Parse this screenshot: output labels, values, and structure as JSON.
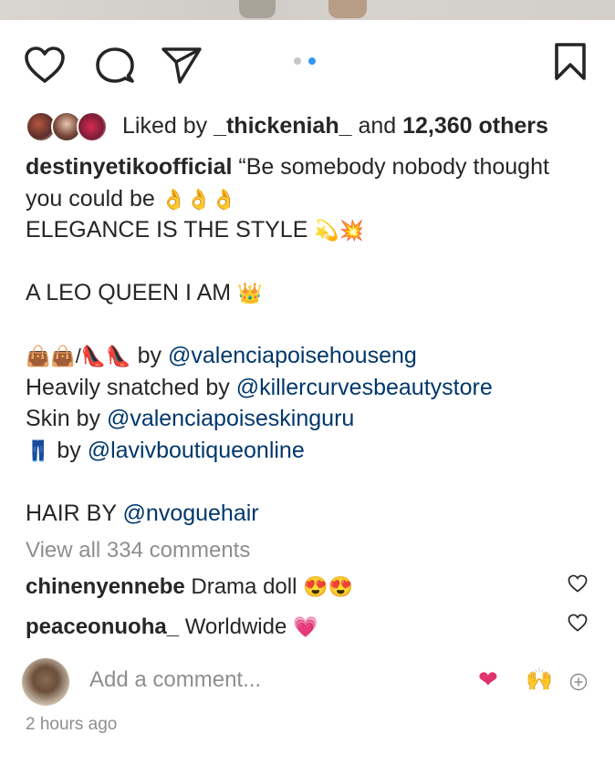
{
  "actions": {
    "like_icon": "heart-outline-icon",
    "comment_icon": "comment-bubble-icon",
    "share_icon": "paper-plane-icon",
    "save_icon": "bookmark-icon",
    "carousel_total": 2,
    "carousel_active": 2
  },
  "likes": {
    "prefix": "Liked by ",
    "user": "_thickeniah_",
    "middle": " and ",
    "count": "12,360 others"
  },
  "caption": {
    "username": "destinyetikoofficial",
    "line1_text": " “Be somebody nobody thought",
    "line2_text": "you could be ",
    "line2_emoji": "👌👌👌",
    "line3_text": "ELEGANCE IS THE STYLE ",
    "line3_emoji": "💫💥",
    "line5_text": "A LEO QUEEN I AM ",
    "line5_emoji": "👑",
    "line7_emoji": "👜👜/👠👠",
    "line7_text": " by ",
    "line7_mention": "@valenciapoisehouseng",
    "line8_text": "Heavily snatched by ",
    "line8_mention": "@killercurvesbeautystore",
    "line9_text": "Skin by ",
    "line9_mention": "@valenciapoiseskinguru",
    "line10_emoji": "👖",
    "line10_text": " by ",
    "line10_mention": "@lavivboutiqueonline",
    "line12_text": "HAIR BY ",
    "line12_mention": "@nvoguehair"
  },
  "view_all": "View all 334 comments",
  "comments": [
    {
      "user": "chinenyennebe",
      "text": " Drama doll ",
      "emoji": "😍😍"
    },
    {
      "user": "peaceonuoha_",
      "text": " Worldwide ",
      "emoji": "💗"
    }
  ],
  "add_comment": {
    "placeholder": "Add a comment...",
    "quick_emoji_1": "❤",
    "quick_emoji_2": "🙌",
    "more_icon": "plus-circle-icon"
  },
  "timestamp": "2 hours ago",
  "colors": {
    "text": "#262626",
    "mention": "#00376b",
    "muted": "#8e8e8e",
    "active_dot": "#3897f0",
    "inactive_dot": "#c7c7c7",
    "heart_pink": "#e0336f"
  }
}
